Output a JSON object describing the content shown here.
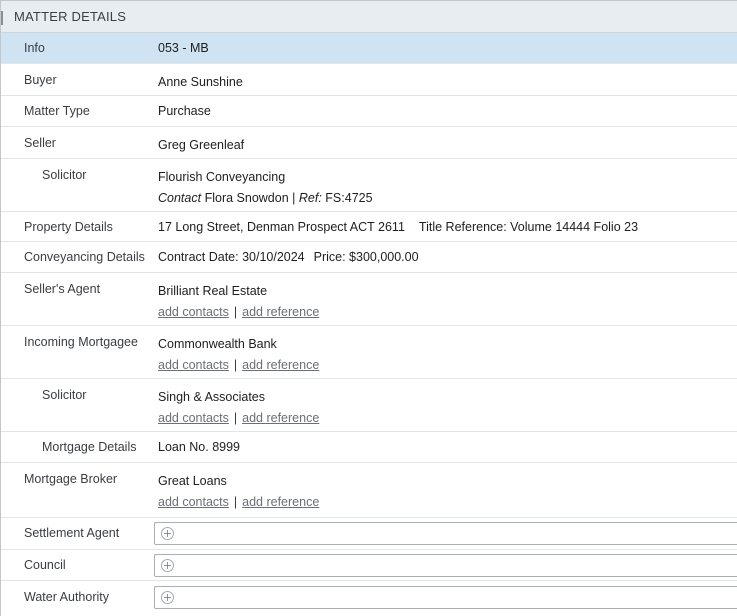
{
  "header": {
    "title": "MATTER DETAILS"
  },
  "rows": {
    "info": {
      "label": "Info",
      "value": "053 - MB"
    },
    "buyer": {
      "label": "Buyer",
      "value": "Anne Sunshine"
    },
    "matter_type": {
      "label": "Matter Type",
      "value": "Purchase"
    },
    "seller": {
      "label": "Seller",
      "value": "Greg Greenleaf"
    },
    "seller_solicitor": {
      "label": "Solicitor",
      "name": "Flourish Conveyancing",
      "contact_label": "Contact",
      "contact_name": "Flora Snowdon",
      "divider": "|",
      "ref_label": "Ref:",
      "ref_value": "FS:4725"
    },
    "property_details": {
      "label": "Property Details",
      "address": "17 Long Street, Denman Prospect ACT 2611",
      "title_reference": "Title Reference: Volume 14444 Folio 23"
    },
    "conveyancing_details": {
      "label": "Conveyancing Details",
      "contract_date": "Contract Date: 30/10/2024",
      "price": "Price: $300,000.00"
    },
    "sellers_agent": {
      "label": "Seller's Agent",
      "value": "Brilliant Real Estate"
    },
    "incoming_mortgagee": {
      "label": "Incoming Mortgagee",
      "value": "Commonwealth Bank"
    },
    "mortgagee_solicitor": {
      "label": "Solicitor",
      "value": "Singh & Associates"
    },
    "mortgage_details": {
      "label": "Mortgage Details",
      "value": "Loan No. 8999"
    },
    "mortgage_broker": {
      "label": "Mortgage Broker",
      "value": "Great Loans"
    },
    "settlement_agent": {
      "label": "Settlement Agent"
    },
    "council": {
      "label": "Council"
    },
    "water_authority": {
      "label": "Water Authority"
    }
  },
  "links": {
    "add_contacts": "add contacts",
    "divider": "|",
    "add_reference": "add reference"
  },
  "icons": {
    "add": "plus-circle-icon"
  }
}
